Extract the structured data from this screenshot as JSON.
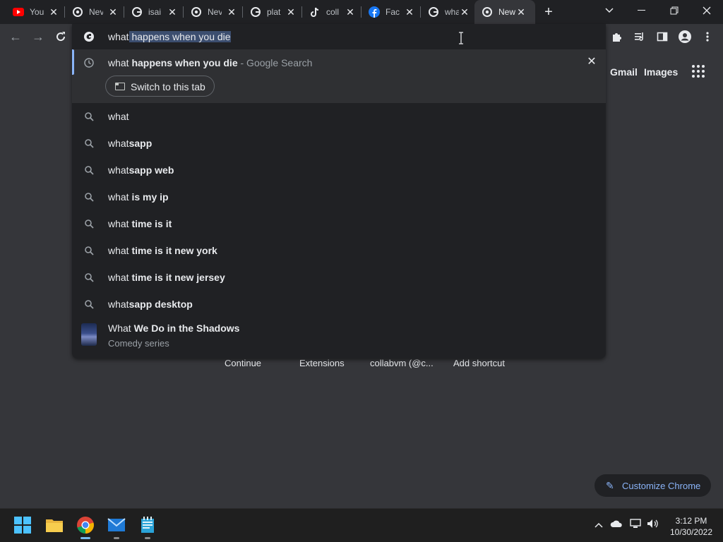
{
  "tabs": [
    {
      "title": "You",
      "icon": "youtube-icon"
    },
    {
      "title": "Nev",
      "icon": "chrome-icon"
    },
    {
      "title": "isai",
      "icon": "google-icon"
    },
    {
      "title": "Nev",
      "icon": "chrome-icon"
    },
    {
      "title": "plat",
      "icon": "google-icon"
    },
    {
      "title": "coll",
      "icon": "tiktok-icon"
    },
    {
      "title": "Fac",
      "icon": "facebook-icon"
    },
    {
      "title": "wha",
      "icon": "google-icon"
    },
    {
      "title": "New",
      "icon": "chrome-icon",
      "active": true
    }
  ],
  "omnibox": {
    "typed": "what",
    "completion": " happens when you die"
  },
  "highlighted_suggestion": {
    "prefix": "what ",
    "bold": "happens when you die",
    "suffix": " - Google Search",
    "switch_label": "Switch to this tab"
  },
  "suggestions": [
    {
      "prefix": "what",
      "bold": ""
    },
    {
      "prefix": "what",
      "bold": "sapp"
    },
    {
      "prefix": "what",
      "bold": "sapp web"
    },
    {
      "prefix": "what ",
      "bold": "is my ip"
    },
    {
      "prefix": "what ",
      "bold": "time is it"
    },
    {
      "prefix": "what ",
      "bold": "time is it new york"
    },
    {
      "prefix": "what ",
      "bold": "time is it new jersey"
    },
    {
      "prefix": "what",
      "bold": "sapp desktop"
    }
  ],
  "entity_suggestion": {
    "prefix": "What ",
    "bold": "We Do in the Shadows",
    "subtitle": "Comedy series"
  },
  "ntp": {
    "gmail": "Gmail",
    "images": "Images",
    "shortcuts": [
      "Continue",
      "Extensions",
      "collabvm (@c...",
      "Add shortcut"
    ],
    "customize_label": "Customize Chrome"
  },
  "taskbar": {
    "time": "3:12 PM",
    "date": "10/30/2022"
  },
  "colors": {
    "accent": "#8ab4f8",
    "dropdown_bg": "#202124",
    "page_bg": "#35363a"
  }
}
